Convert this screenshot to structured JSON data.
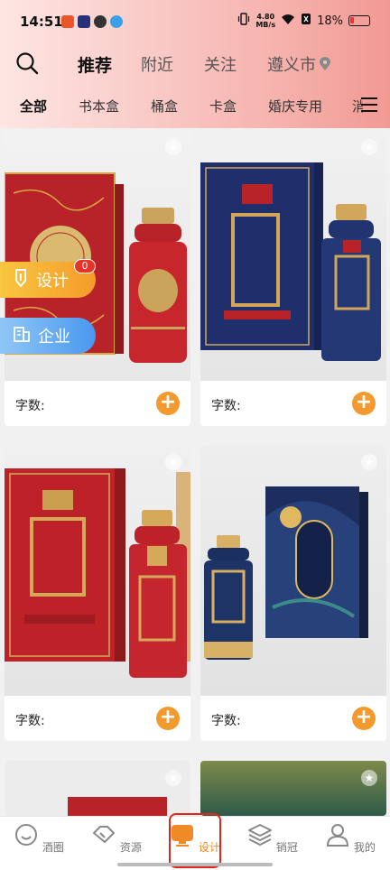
{
  "status_bar": {
    "time": "14:51",
    "net_speed_value": "4.80",
    "net_speed_unit": "MB/s",
    "battery": "18%"
  },
  "top_tabs": [
    {
      "label": "推荐",
      "active": true
    },
    {
      "label": "附近",
      "active": false
    },
    {
      "label": "关注",
      "active": false
    },
    {
      "label": "遵义市",
      "active": false
    }
  ],
  "categories": [
    {
      "label": "全部",
      "active": true
    },
    {
      "label": "书本盒",
      "active": false
    },
    {
      "label": "桶盒",
      "active": false
    },
    {
      "label": "卡盒",
      "active": false
    },
    {
      "label": "婚庆专用",
      "active": false
    },
    {
      "label": "消",
      "active": false
    }
  ],
  "cards": [
    {
      "label": "字数:",
      "add": "+"
    },
    {
      "label": "字数:",
      "add": "+"
    },
    {
      "label": "字数:",
      "add": "+"
    },
    {
      "label": "字数:",
      "add": "+"
    }
  ],
  "floating": {
    "design_label": "设计",
    "design_badge": "0",
    "company_label": "企业"
  },
  "bottom_nav": [
    {
      "label": "酒圈",
      "icon": "smile-circle-icon",
      "active": false
    },
    {
      "label": "资源",
      "icon": "handshake-icon",
      "active": false
    },
    {
      "label": "设计",
      "icon": "design-board-icon",
      "active": true
    },
    {
      "label": "销冠",
      "icon": "layers-icon",
      "active": false
    },
    {
      "label": "我的",
      "icon": "user-icon",
      "active": false
    }
  ],
  "colors": {
    "accent": "#f29a2e",
    "active_nav": "#f08a26",
    "badge": "#e8322a",
    "highlight_box": "#e2261d"
  }
}
